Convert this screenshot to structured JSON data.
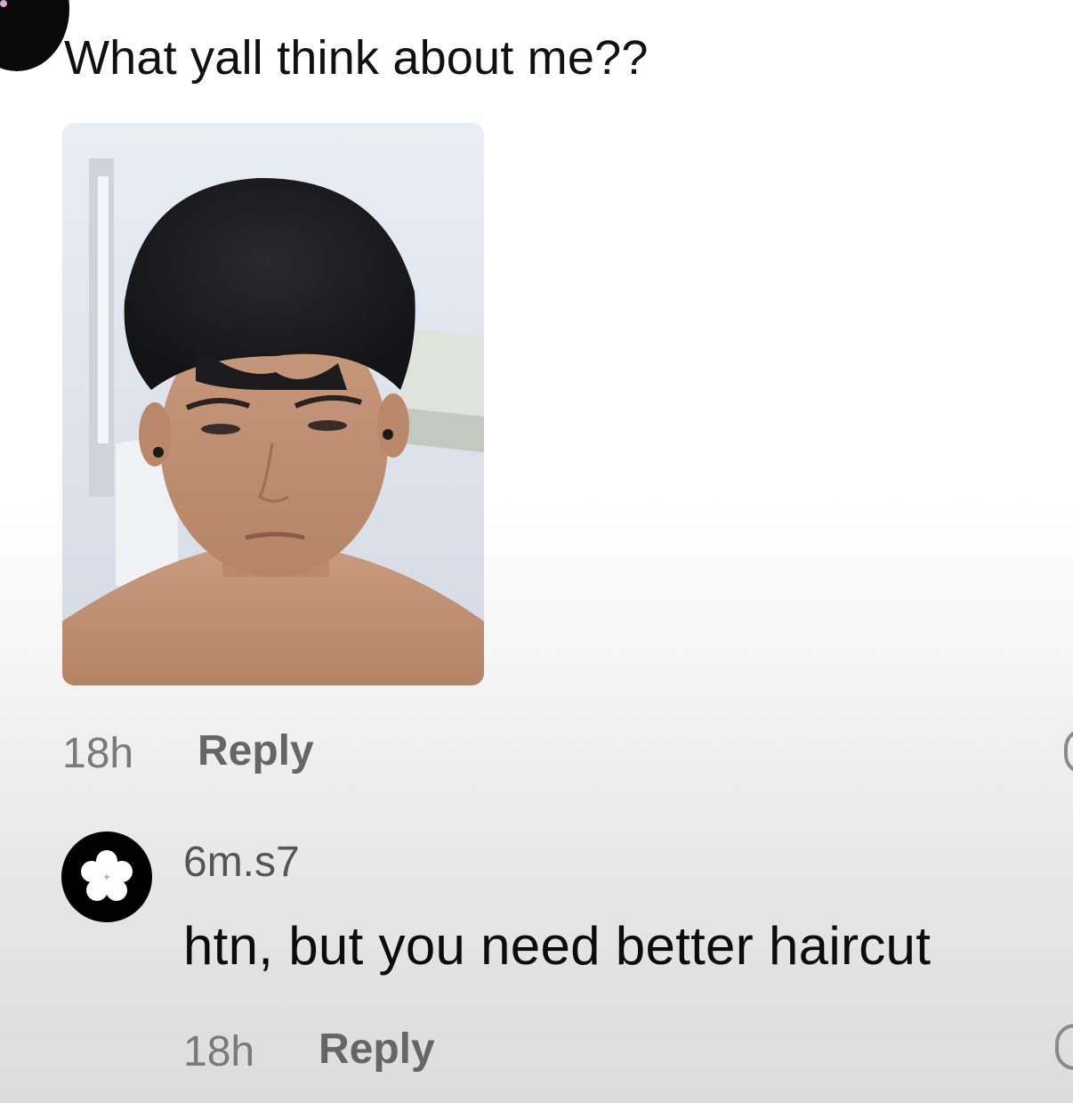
{
  "post": {
    "text": "What yall think about me??",
    "time": "18h",
    "reply_label": "Reply",
    "photo_icon": "selfie-photo"
  },
  "reply": {
    "username": "6m.s7",
    "text": "htn, but you need better haircut",
    "time": "18h",
    "reply_label": "Reply",
    "avatar_icon": "flower-icon"
  },
  "colors": {
    "text_primary": "#111111",
    "text_secondary": "#7a7a7a",
    "reply_label": "#666666",
    "avatar_bg": "#000000"
  }
}
